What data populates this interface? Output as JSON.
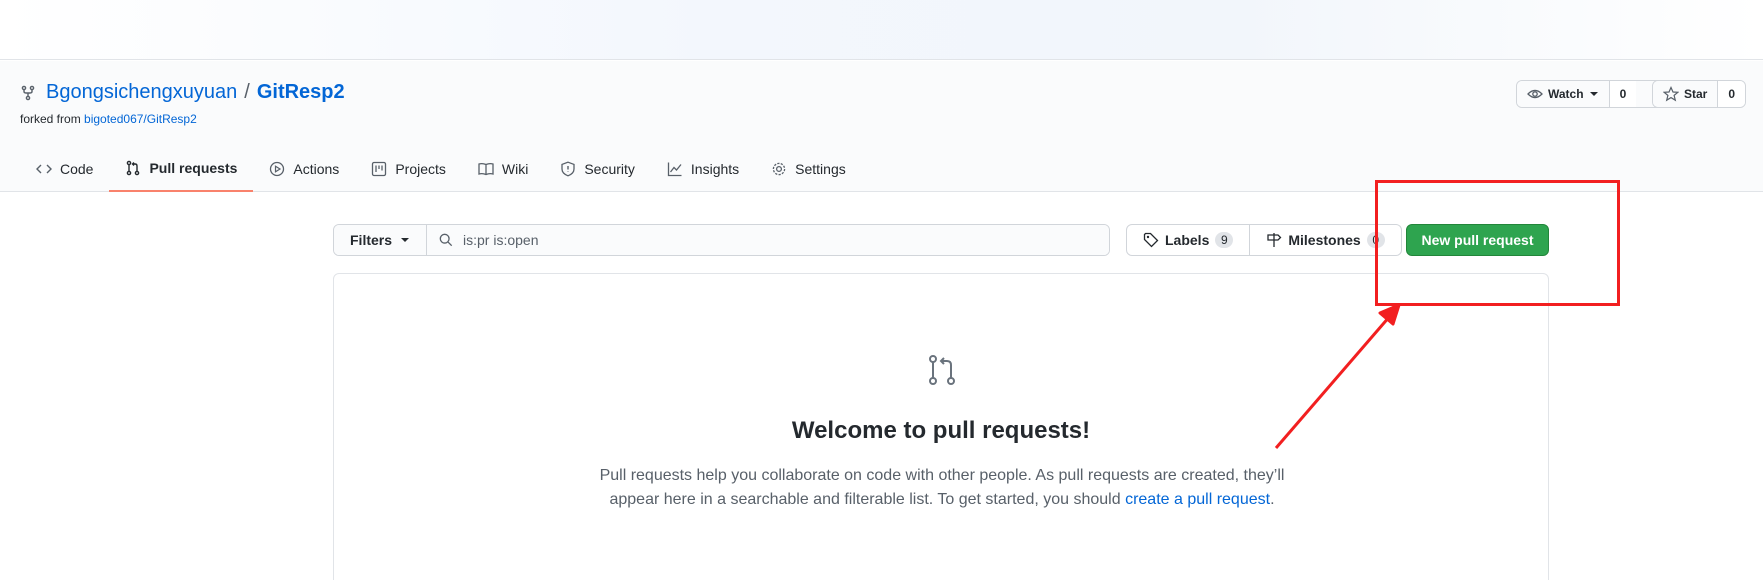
{
  "repo": {
    "owner": "Bgongsichengxuyuan",
    "separator": "/",
    "name": "GitResp2",
    "forked_prefix": "forked from",
    "forked_from": "bigoted067/GitResp2"
  },
  "social": {
    "watch_label": "Watch",
    "watch_count": "0",
    "star_label": "Star",
    "star_count": "0"
  },
  "tabs": [
    {
      "label": "Code",
      "icon": "code-icon"
    },
    {
      "label": "Pull requests",
      "icon": "pull-request-icon",
      "active": true
    },
    {
      "label": "Actions",
      "icon": "play-icon"
    },
    {
      "label": "Projects",
      "icon": "project-icon"
    },
    {
      "label": "Wiki",
      "icon": "book-icon"
    },
    {
      "label": "Security",
      "icon": "shield-icon"
    },
    {
      "label": "Insights",
      "icon": "graph-icon"
    },
    {
      "label": "Settings",
      "icon": "gear-icon"
    }
  ],
  "filters": {
    "button_label": "Filters",
    "search_value": "is:pr is:open"
  },
  "labels": {
    "label": "Labels",
    "count": "9"
  },
  "milestones": {
    "label": "Milestones",
    "count": "0"
  },
  "new_pr_label": "New pull request",
  "blankslate": {
    "heading": "Welcome to pull requests!",
    "desc_line1": "Pull requests help you collaborate on code with other people. As pull requests are created, they’ll",
    "desc_line2": "appear here in a searchable and filterable list. To get started, you should",
    "desc_link": "create a pull request",
    "desc_end": "."
  },
  "colors": {
    "link": "#0366d6",
    "primary_button": "#2ea44f",
    "active_tab_underline": "#f9826c",
    "annotation": "#f21f20"
  }
}
